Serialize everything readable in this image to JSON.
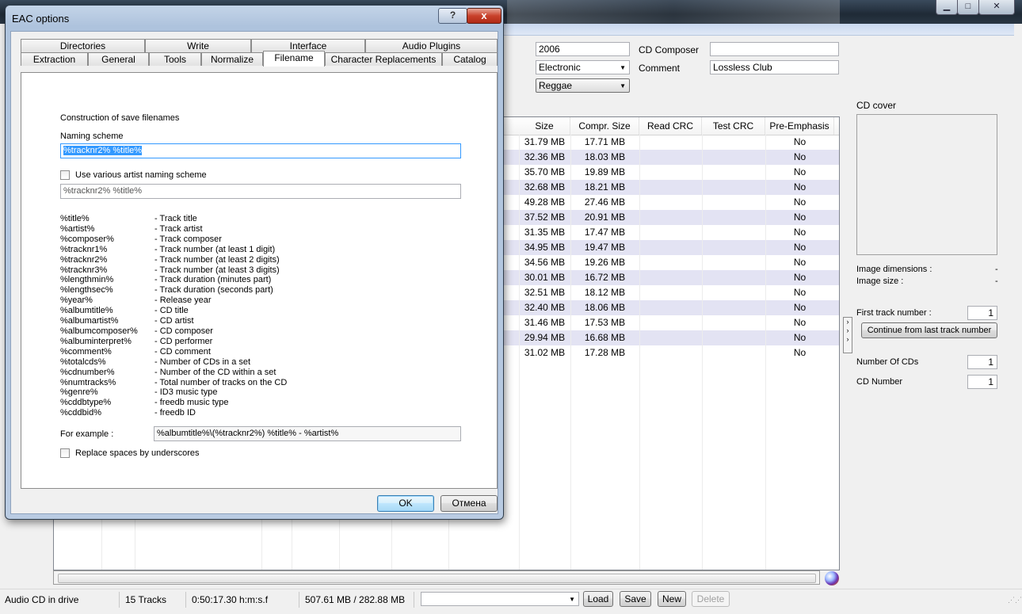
{
  "main_window": {
    "titlebar_buttons": {
      "minimize": "▁",
      "maximize": "□",
      "close": "✕"
    },
    "cd_info": {
      "year": "2006",
      "genre_primary": "Electronic",
      "genre_secondary": "Reggae",
      "cd_composer_label": "CD Composer",
      "cd_composer_value": "",
      "comment_label": "Comment",
      "comment_value": "Lossless Club"
    },
    "table": {
      "columns": [
        "Size",
        "Compr. Size",
        "Read CRC",
        "Test CRC",
        "Pre-Emphasis"
      ],
      "rows": [
        {
          "size": "31.79 MB",
          "compr": "17.71 MB",
          "read_crc": "",
          "test_crc": "",
          "pre": "No"
        },
        {
          "size": "32.36 MB",
          "compr": "18.03 MB",
          "read_crc": "",
          "test_crc": "",
          "pre": "No"
        },
        {
          "size": "35.70 MB",
          "compr": "19.89 MB",
          "read_crc": "",
          "test_crc": "",
          "pre": "No"
        },
        {
          "size": "32.68 MB",
          "compr": "18.21 MB",
          "read_crc": "",
          "test_crc": "",
          "pre": "No"
        },
        {
          "size": "49.28 MB",
          "compr": "27.46 MB",
          "read_crc": "",
          "test_crc": "",
          "pre": "No"
        },
        {
          "size": "37.52 MB",
          "compr": "20.91 MB",
          "read_crc": "",
          "test_crc": "",
          "pre": "No"
        },
        {
          "size": "31.35 MB",
          "compr": "17.47 MB",
          "read_crc": "",
          "test_crc": "",
          "pre": "No"
        },
        {
          "size": "34.95 MB",
          "compr": "19.47 MB",
          "read_crc": "",
          "test_crc": "",
          "pre": "No"
        },
        {
          "size": "34.56 MB",
          "compr": "19.26 MB",
          "read_crc": "",
          "test_crc": "",
          "pre": "No"
        },
        {
          "size": "30.01 MB",
          "compr": "16.72 MB",
          "read_crc": "",
          "test_crc": "",
          "pre": "No"
        },
        {
          "size": "32.51 MB",
          "compr": "18.12 MB",
          "read_crc": "",
          "test_crc": "",
          "pre": "No"
        },
        {
          "size": "32.40 MB",
          "compr": "18.06 MB",
          "read_crc": "",
          "test_crc": "",
          "pre": "No"
        },
        {
          "size": "31.46 MB",
          "compr": "17.53 MB",
          "read_crc": "",
          "test_crc": "",
          "pre": "No"
        },
        {
          "size": "29.94 MB",
          "compr": "16.68 MB",
          "read_crc": "",
          "test_crc": "",
          "pre": "No"
        },
        {
          "size": "31.02 MB",
          "compr": "17.28 MB",
          "read_crc": "",
          "test_crc": "",
          "pre": "No"
        }
      ]
    },
    "cover_panel": {
      "cd_cover_label": "CD cover",
      "image_dimensions_label": "Image dimensions :",
      "image_dimensions_value": "-",
      "image_size_label": "Image size :",
      "image_size_value": "-",
      "first_track_label": "First track number :",
      "first_track_value": "1",
      "continue_button": "Continue from last track number",
      "number_of_cds_label": "Number Of CDs",
      "number_of_cds_value": "1",
      "cd_number_label": "CD Number",
      "cd_number_value": "1"
    },
    "statusbar": {
      "drive_status": "Audio CD in drive",
      "tracks": "15 Tracks",
      "duration": "0:50:17.30 h:m:s.f",
      "sizes": "507.61 MB / 282.88 MB",
      "load_button": "Load",
      "save_button": "Save",
      "new_button": "New",
      "delete_button": "Delete"
    }
  },
  "dialog": {
    "title": "EAC options",
    "help_button": "?",
    "close_button": "x",
    "tabs_row1": [
      "Directories",
      "Write",
      "Interface",
      "Audio Plugins"
    ],
    "tabs_row2": [
      "Extraction",
      "General",
      "Tools",
      "Normalize",
      "Filename",
      "Character Replacements",
      "Catalog"
    ],
    "active_tab": "Filename",
    "construction_label": "Construction of save filenames",
    "naming_scheme_label": "Naming scheme",
    "naming_scheme_value": "%tracknr2% %title%",
    "various_artist_checkbox_label": "Use various artist naming scheme",
    "various_artist_checked": false,
    "various_artist_scheme_value": "%tracknr2% %title%",
    "variables": [
      {
        "var": "%title%",
        "desc": "- Track title"
      },
      {
        "var": "%artist%",
        "desc": "- Track artist"
      },
      {
        "var": "%composer%",
        "desc": "- Track composer"
      },
      {
        "var": "%tracknr1%",
        "desc": "- Track number (at least 1 digit)"
      },
      {
        "var": "%tracknr2%",
        "desc": "- Track number (at least 2 digits)"
      },
      {
        "var": "%tracknr3%",
        "desc": "- Track number (at least 3 digits)"
      },
      {
        "var": "%lengthmin%",
        "desc": "- Track duration (minutes part)"
      },
      {
        "var": "%lengthsec%",
        "desc": "- Track duration (seconds part)"
      },
      {
        "var": "%year%",
        "desc": "- Release year"
      },
      {
        "var": "%albumtitle%",
        "desc": "- CD title"
      },
      {
        "var": "%albumartist%",
        "desc": "- CD artist"
      },
      {
        "var": "%albumcomposer%",
        "desc": "- CD composer"
      },
      {
        "var": "%albuminterpret%",
        "desc": "- CD performer"
      },
      {
        "var": "%comment%",
        "desc": "- CD comment"
      },
      {
        "var": "%totalcds%",
        "desc": "- Number of CDs in a set"
      },
      {
        "var": "%cdnumber%",
        "desc": "- Number of the CD within a set"
      },
      {
        "var": "%numtracks%",
        "desc": "- Total number of tracks on the CD"
      },
      {
        "var": "%genre%",
        "desc": "- ID3 music type"
      },
      {
        "var": "%cddbtype%",
        "desc": "- freedb music type"
      },
      {
        "var": "%cddbid%",
        "desc": "- freedb ID"
      }
    ],
    "for_example_label": "For example :",
    "for_example_value": "%albumtitle%\\(%tracknr2%) %title% - %artist%",
    "replace_spaces_label": "Replace spaces by underscores",
    "replace_spaces_checked": false,
    "ok_button": "OK",
    "cancel_button": "Отмена"
  }
}
